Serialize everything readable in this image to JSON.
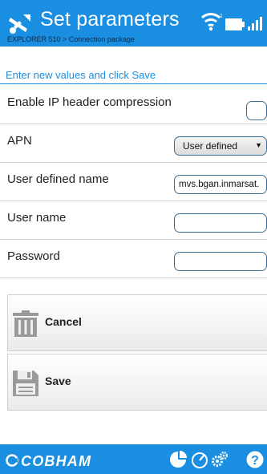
{
  "header": {
    "title": "Set parameters",
    "breadcrumb": "EXPLORER 510 > Connection package",
    "icons": [
      "tools-icon",
      "wifi-icon",
      "battery-icon",
      "signal-icon"
    ]
  },
  "form": {
    "instruction": "Enter new values and click Save",
    "fields": {
      "ip_header_compression": {
        "label": "Enable IP header compression",
        "checked": false
      },
      "apn": {
        "label": "APN",
        "value": "User defined"
      },
      "user_defined_name": {
        "label": "User defined name",
        "value": "mvs.bgan.inmarsat."
      },
      "user_name": {
        "label": "User name",
        "value": ""
      },
      "password": {
        "label": "Password",
        "value": ""
      }
    }
  },
  "actions": {
    "cancel_label": "Cancel",
    "save_label": "Save"
  },
  "footer": {
    "brand": "COBHAM",
    "icons": [
      "pie-chart-icon",
      "gauge-icon",
      "settings-icon",
      "help-icon"
    ]
  },
  "colors": {
    "accent": "#1a8ee0",
    "border": "#3a6f95",
    "breadcrumb_text": "#0b2b4a"
  }
}
